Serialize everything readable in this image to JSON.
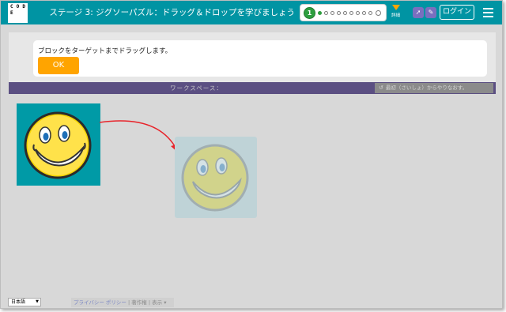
{
  "header": {
    "logo_letters": [
      "C",
      "O",
      "D",
      "E",
      "",
      "",
      "",
      "",
      ""
    ],
    "title": "ステージ 3: ジグソーパズル：ドラッグ＆ドロップを学びましょう",
    "progress": {
      "current_level": "1",
      "dots_completed": 1,
      "dots_total": 11
    },
    "level_label": "詳細",
    "login_label": "ログイン",
    "icons": [
      "rocket-icon",
      "pencil-icon"
    ]
  },
  "dialog": {
    "instruction": "ブロックをターゲットまでドラッグします。",
    "ok_label": "OK"
  },
  "workspace": {
    "label": "ワークスペース：",
    "reset_label": "最初（さいしょ）からやりなおす。"
  },
  "footer": {
    "language": "日本語",
    "privacy": "プライバシー ポリシー",
    "copyright": "著作権",
    "more": "表示 ▾"
  },
  "colors": {
    "header": "#0094a3",
    "accent": "#ffa400",
    "workspace_bar": "#5b4f82",
    "block_bg": "#009aa6",
    "progress_green": "#2e9e3f"
  }
}
